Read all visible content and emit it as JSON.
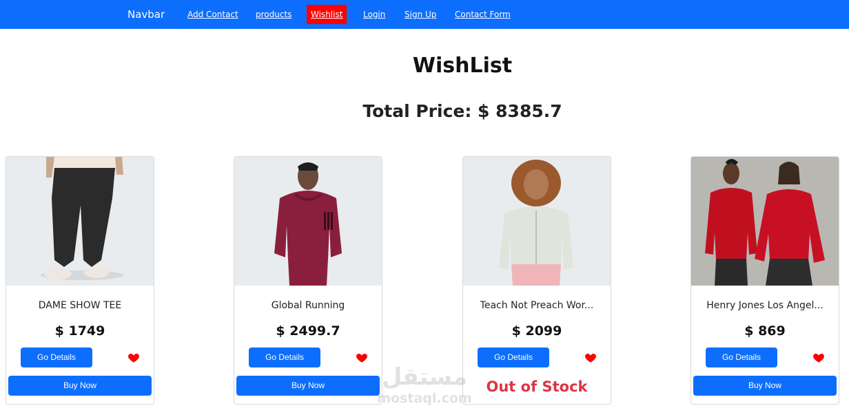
{
  "navbar": {
    "brand": "Navbar",
    "links": [
      {
        "label": "Add Contact"
      },
      {
        "label": "products"
      },
      {
        "label": "Wishlist"
      },
      {
        "label": "Login"
      },
      {
        "label": "Sign Up"
      },
      {
        "label": "Contact Form"
      }
    ],
    "active_link": "Wishlist",
    "bar_color": "#0d6efd",
    "active_color": "#ff0000"
  },
  "page": {
    "title": "WishList",
    "total_label": "Total Price: $ 8385.7"
  },
  "products": [
    {
      "title": "DAME SHOW TEE",
      "price": "$ 1749",
      "details_label": "Go Details",
      "action": "Buy Now",
      "image_icon": "pants-model-image"
    },
    {
      "title": "Global Running",
      "price": "$ 2499.7",
      "details_label": "Go Details",
      "action": "Buy Now",
      "image_icon": "hoodie-model-image"
    },
    {
      "title": "Teach Not Preach Wor...",
      "price": "$ 2099",
      "details_label": "Go Details",
      "action": "Out of Stock",
      "image_icon": "zip-hoodie-model-image"
    },
    {
      "title": "Henry Jones Los Angel...",
      "price": "$ 869",
      "details_label": "Go Details",
      "action": "Buy Now",
      "image_icon": "red-hoodies-models-image"
    }
  ],
  "watermark": {
    "arabic": "مستقل",
    "latin": "mostaql.com"
  },
  "colors": {
    "primary": "#0d6efd",
    "heart": "#ff0000",
    "out_of_stock": "#dc3545"
  }
}
